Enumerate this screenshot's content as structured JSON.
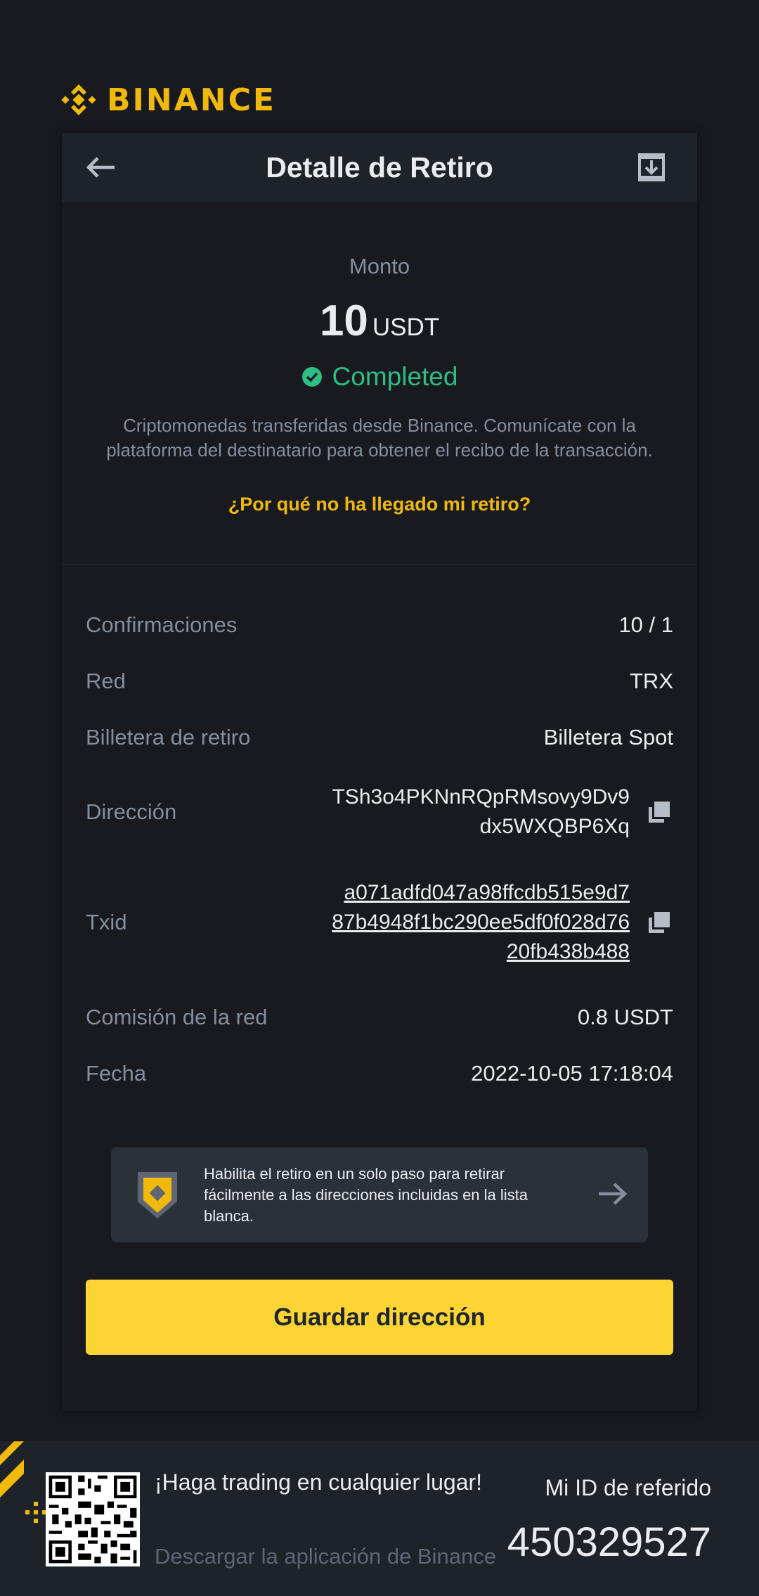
{
  "brand": {
    "name": "BINANCE",
    "logo_icon": "binance-diamond-logo",
    "color": "#F0B90B"
  },
  "header": {
    "title": "Detalle de Retiro",
    "back_icon": "arrow-left-icon",
    "export_icon": "export-icon"
  },
  "summary": {
    "amount_label": "Monto",
    "amount_value": "10",
    "amount_currency": "USDT",
    "status": "Completed",
    "status_color": "#2EBD85",
    "description": "Criptomonedas transferidas desde Binance. Comunícate con la plataforma del destinatario para obtener el recibo de la transacción.",
    "help_link": "¿Por qué no ha llegado mi retiro?"
  },
  "details": {
    "confirmations": {
      "label": "Confirmaciones",
      "value": "10 / 1"
    },
    "network": {
      "label": "Red",
      "value": "TRX"
    },
    "wallet": {
      "label": "Billetera de retiro",
      "value": "Billetera Spot"
    },
    "address": {
      "label": "Dirección",
      "line1": "TSh3o4PKNnRQpRMsovy9Dv9",
      "line2": "dx5WXQBP6Xq"
    },
    "txid": {
      "label": "Txid",
      "line1": "a071adfd047a98ffcdb515e9d7",
      "line2": "87b4948f1bc290ee5df0f028d76",
      "line3": "20fb438b488"
    },
    "fee": {
      "label": "Comisión de la red",
      "value": "0.8 USDT"
    },
    "date": {
      "label": "Fecha",
      "value": "2022-10-05 17:18:04"
    }
  },
  "promo": {
    "text": "Habilita el retiro en un solo paso para retirar fácilmente a las direcciones incluidas en la lista blanca."
  },
  "actions": {
    "save_label": "Guardar dirección",
    "accent": "#FCD535"
  },
  "footer": {
    "cta": "¡Haga trading en cualquier lugar!",
    "download": "Descargar la aplicación de Binance",
    "ref_label": "Mi ID de referido",
    "ref_id": "450329527"
  }
}
